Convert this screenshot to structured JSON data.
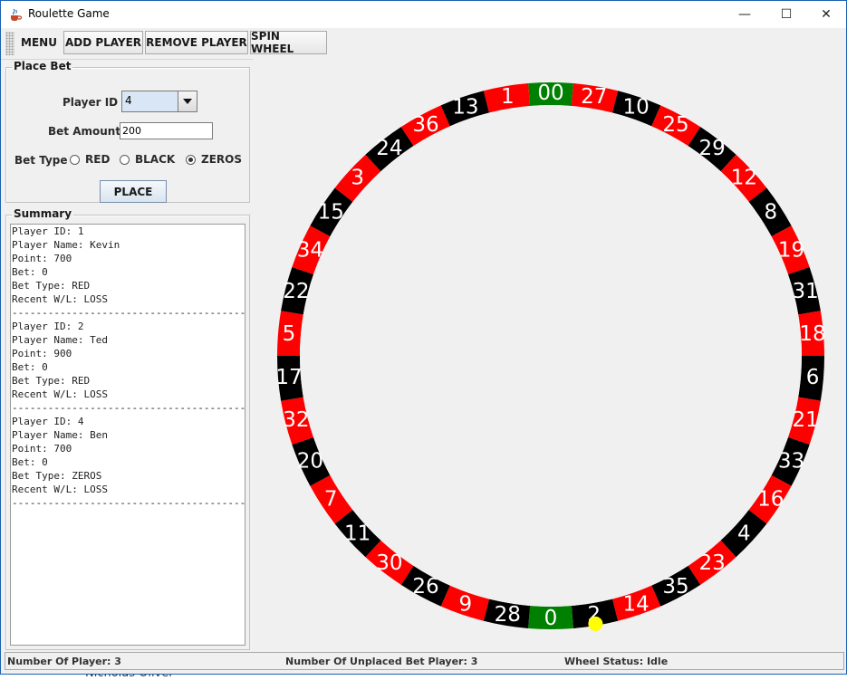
{
  "window": {
    "title": "Roulette Game"
  },
  "titlebar": {
    "minimize": "—",
    "maximize": "☐",
    "close": "✕"
  },
  "toolbar": {
    "menu_label": "MENU",
    "add_player_label": "ADD PLAYER",
    "remove_player_label": "REMOVE PLAYER",
    "spin_wheel_label": "SPIN WHEEL"
  },
  "place_bet": {
    "legend": "Place Bet",
    "player_id_label": "Player ID",
    "player_id_value": "4",
    "bet_amount_label": "Bet Amount",
    "bet_amount_value": "200",
    "bet_type_label": "Bet Type",
    "bet_types": [
      "RED",
      "BLACK",
      "ZEROS"
    ],
    "selected_bet_type": "ZEROS",
    "place_button": "PLACE"
  },
  "summary": {
    "legend": "Summary",
    "text": "Player ID: 1\nPlayer Name: Kevin\nPoint: 700\nBet: 0\nBet Type: RED\nRecent W/L: LOSS\n----------------------------------------\nPlayer ID: 2\nPlayer Name: Ted\nPoint: 900\nBet: 0\nBet Type: RED\nRecent W/L: LOSS\n----------------------------------------\nPlayer ID: 4\nPlayer Name: Ben\nPoint: 700\nBet: 0\nBet Type: ZEROS\nRecent W/L: LOSS\n----------------------------------------"
  },
  "wheel": {
    "numbers": [
      "00",
      "27",
      "10",
      "25",
      "29",
      "12",
      "8",
      "19",
      "31",
      "18",
      "6",
      "21",
      "33",
      "16",
      "4",
      "23",
      "35",
      "14",
      "2",
      "0",
      "28",
      "9",
      "26",
      "30",
      "11",
      "7",
      "20",
      "32",
      "17",
      "5",
      "22",
      "34",
      "15",
      "3",
      "24",
      "36",
      "13",
      "1"
    ],
    "colors": {
      "00": "green",
      "27": "red",
      "10": "black",
      "25": "red",
      "29": "black",
      "12": "red",
      "8": "black",
      "19": "red",
      "31": "black",
      "18": "red",
      "6": "black",
      "21": "red",
      "33": "black",
      "16": "red",
      "4": "black",
      "23": "red",
      "35": "black",
      "14": "red",
      "2": "black",
      "0": "green",
      "28": "black",
      "9": "red",
      "26": "black",
      "30": "red",
      "11": "black",
      "7": "red",
      "20": "black",
      "32": "red",
      "17": "black",
      "5": "red",
      "22": "black",
      "34": "red",
      "15": "black",
      "3": "red",
      "24": "black",
      "36": "red",
      "13": "black",
      "1": "red"
    },
    "palette": {
      "red": "#ff0000",
      "black": "#000000",
      "green": "#008000",
      "ball": "#ffff00",
      "background": "#f0f0f0"
    },
    "ball_pocket": "2"
  },
  "status": {
    "players": "Number Of Player: 3",
    "unplaced": "Number Of Unplaced Bet Player: 3",
    "wheel_status": "Wheel Status: Idle"
  },
  "background_text": "Nicholas Oliver"
}
